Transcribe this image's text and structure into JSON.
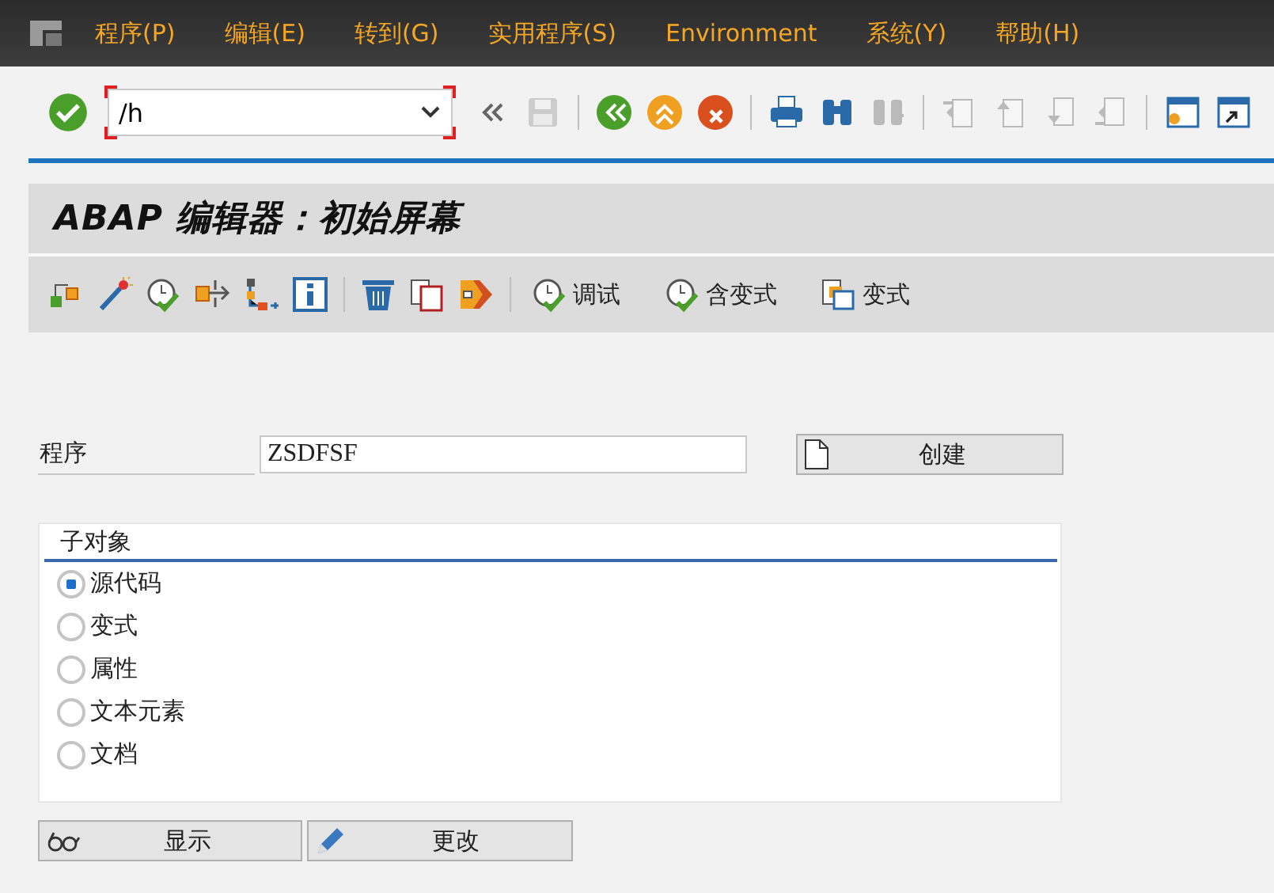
{
  "menu": [
    {
      "label": "程序(P)"
    },
    {
      "label": "编辑(E)"
    },
    {
      "label": "转到(G)"
    },
    {
      "label": "实用程序(S)"
    },
    {
      "label": "Environment"
    },
    {
      "label": "系统(Y)"
    },
    {
      "label": "帮助(H)"
    }
  ],
  "command_field": {
    "value": "/h"
  },
  "system_toolbar": [
    {
      "kind": "collapse",
      "disabled": false
    },
    {
      "kind": "save",
      "disabled": true
    },
    {
      "kind": "sep"
    },
    {
      "kind": "back",
      "disabled": false
    },
    {
      "kind": "exit",
      "disabled": false
    },
    {
      "kind": "cancel",
      "disabled": false
    },
    {
      "kind": "sep"
    },
    {
      "kind": "print",
      "disabled": false
    },
    {
      "kind": "find",
      "disabled": false
    },
    {
      "kind": "find-next",
      "disabled": true
    },
    {
      "kind": "sep"
    },
    {
      "kind": "first-page",
      "disabled": true
    },
    {
      "kind": "prev-page",
      "disabled": true
    },
    {
      "kind": "next-page",
      "disabled": true
    },
    {
      "kind": "last-page",
      "disabled": true
    },
    {
      "kind": "sep"
    },
    {
      "kind": "new-session",
      "disabled": false
    },
    {
      "kind": "shortcut",
      "disabled": false
    }
  ],
  "title": "ABAP 编辑器：初始屏幕",
  "app_toolbar": [
    {
      "kind": "object-list"
    },
    {
      "kind": "wand"
    },
    {
      "kind": "check"
    },
    {
      "kind": "where-used"
    },
    {
      "kind": "hierarchy"
    },
    {
      "kind": "info"
    },
    {
      "kind": "sep"
    },
    {
      "kind": "delete"
    },
    {
      "kind": "copy"
    },
    {
      "kind": "rename"
    },
    {
      "kind": "sep"
    },
    {
      "kind": "debug",
      "label": "调试"
    },
    {
      "kind": "debug",
      "label": "含变式"
    },
    {
      "kind": "variant",
      "label": "变式"
    }
  ],
  "program": {
    "label": "程序",
    "value": "ZSDFSF"
  },
  "create_button": {
    "label": "创建"
  },
  "subobjects": {
    "title": "子对象",
    "options": [
      {
        "label": "源代码",
        "selected": true
      },
      {
        "label": "变式",
        "selected": false
      },
      {
        "label": "属性",
        "selected": false
      },
      {
        "label": "文本元素",
        "selected": false
      },
      {
        "label": "文档",
        "selected": false
      }
    ]
  },
  "buttons": [
    {
      "kind": "display",
      "label": "显示"
    },
    {
      "kind": "change",
      "label": "更改"
    }
  ]
}
